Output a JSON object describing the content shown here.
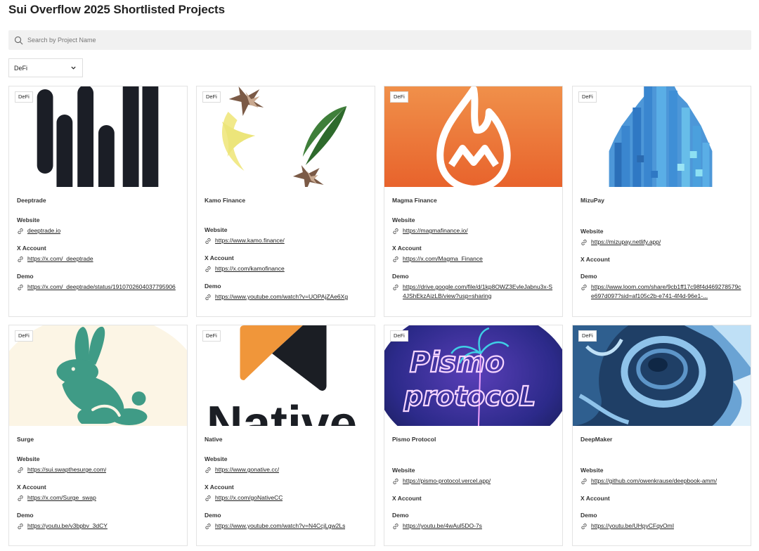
{
  "header": {
    "title": "Sui Overflow 2025 Shortlisted Projects"
  },
  "search": {
    "placeholder": "Search by Project Name"
  },
  "filter": {
    "selected": "DeFi"
  },
  "labels": {
    "website": "Website",
    "x_account": "X Account",
    "demo": "Demo"
  },
  "projects": [
    {
      "name": "Deeptrade",
      "category": "DeFi",
      "website": "deeptrade.io",
      "x_account": "https://x.com/_deeptrade",
      "demo": "https://x.com/_deeptrade/status/1910702604037795906"
    },
    {
      "name": "Kamo Finance",
      "category": "DeFi",
      "website": "https://www.kamo.finance/",
      "x_account": "https://x.com/kamofinance",
      "demo": "https://www.youtube.com/watch?v=UOPAjZAe6Xg"
    },
    {
      "name": "Magma Finance",
      "category": "DeFi",
      "website": "https://magmafinance.io/",
      "x_account": "https://x.com/Magma_Finance",
      "demo": "https://drive.google.com/file/d/1kp8OWZ3EvleJabnu3x-S4JShEkzAizLB/view?usp=sharing"
    },
    {
      "name": "MizuPay",
      "category": "DeFi",
      "website": "https://mizupay.netlify.app/",
      "x_account": "",
      "demo": "https://www.loom.com/share/9cb1ff17c98f4d469278579ce697d097?sid=af105c2b-e741-4f4d-96e1-..."
    },
    {
      "name": "Surge",
      "category": "DeFi",
      "website": "https://sui.swapthesurge.com/",
      "x_account": "https://x.com/Surge_swap",
      "demo": "https://youtu.be/v3bpbv_3dCY"
    },
    {
      "name": "Native",
      "category": "DeFi",
      "website": "https://www.gonative.cc/",
      "x_account": "https://x.com/goNativeCC",
      "demo": "https://www.youtube.com/watch?v=N4CcjLgw2Ls"
    },
    {
      "name": "Pismo Protocol",
      "category": "DeFi",
      "website": "https://pismo-protocol.vercel.app/",
      "x_account": "",
      "demo": "https://youtu.be/4wAul5DO-7s"
    },
    {
      "name": "DeepMaker",
      "category": "DeFi",
      "website": "https://github.com/owenkrause/deepbook-amm/",
      "x_account": "",
      "demo": "https://youtu.be/UHpyCFqvOmI"
    }
  ],
  "logo_text": {
    "native": "Native",
    "pismo_1": "Pismo",
    "pismo_2": "protocoL"
  },
  "colors": {
    "magma_bg": "#ee7a3c",
    "surge_green": "#3f9b86",
    "native_orange": "#f0963a",
    "native_dark": "#1b1e24"
  }
}
